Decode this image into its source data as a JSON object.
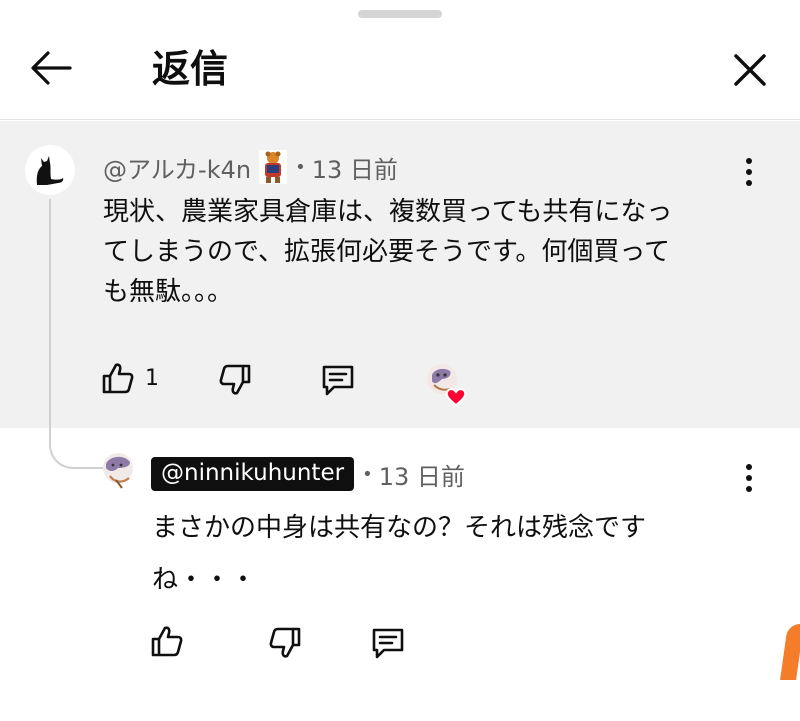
{
  "header": {
    "title": "返信"
  },
  "parent_comment": {
    "handle": "@アルカ-k4n",
    "time": "13 日前",
    "lines": [
      "現状、農業家具倉庫は、複数買っても共有になっ",
      "てしまうので、拡張何必要そうです。何個買って",
      "も無駄。。。"
    ],
    "like_count": "1",
    "icons": {
      "avatar": "cat-silhouette-icon",
      "badge": "member-badge-icon",
      "like": "thumbs-up-icon",
      "dislike": "thumbs-down-icon",
      "reply": "reply-icon",
      "more": "more-vert-icon",
      "creator_heart": "creator-heart-icon"
    }
  },
  "reply_comment": {
    "handle": "@ninnikuhunter",
    "time": "13 日前",
    "lines": [
      "まさかの中身は共有なの？それは残念です",
      "ね・・・"
    ]
  },
  "colors": {
    "parent_bg": "#f1f1f1",
    "heart": "#ff0033",
    "accent_orange": "#f57c28"
  }
}
